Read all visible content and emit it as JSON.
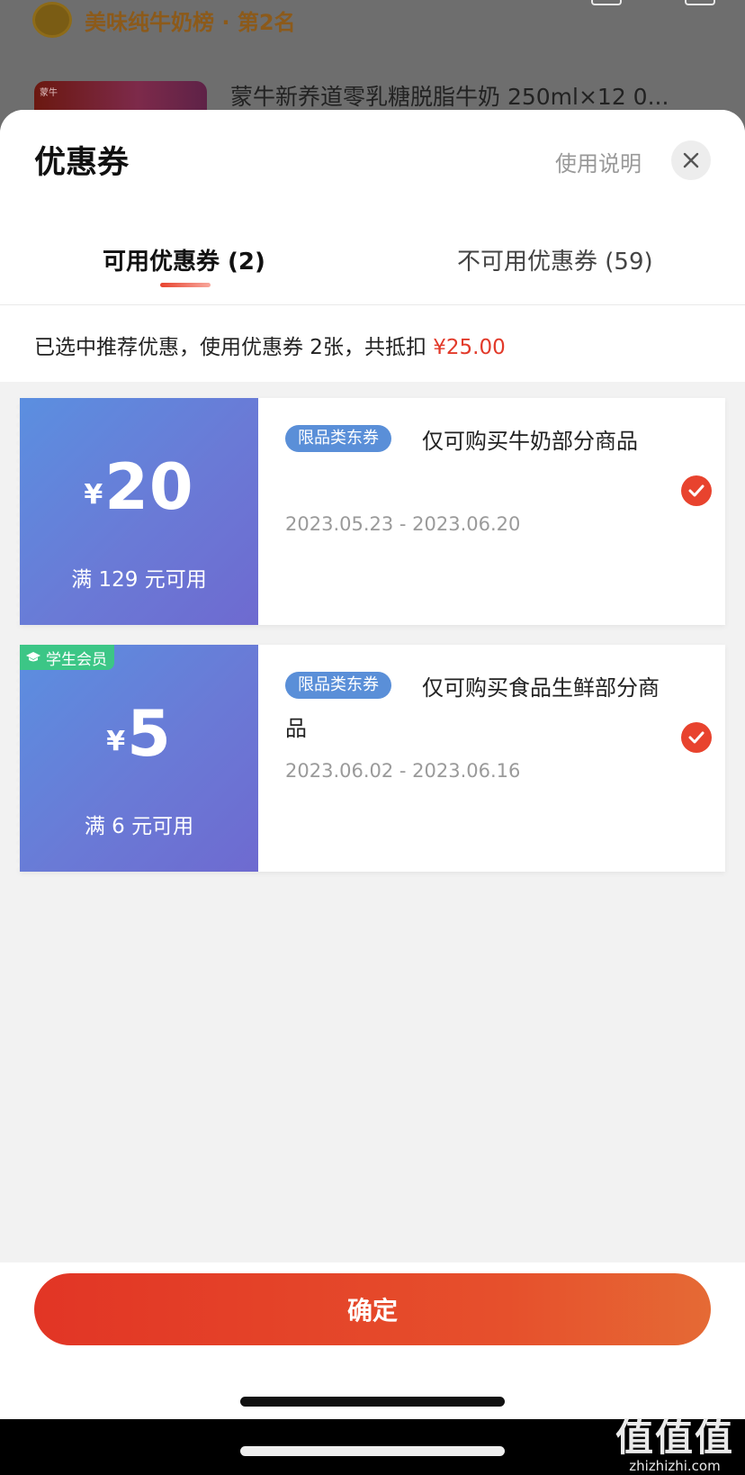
{
  "background": {
    "rank_text": "美味纯牛奶榜 · 第2名",
    "product_title": "蒙牛新养道零乳糖脱脂牛奶 250ml×12 0...",
    "thumb_brand": "蒙牛"
  },
  "sheet": {
    "title": "优惠券",
    "help_link": "使用说明",
    "close_icon": "close-icon"
  },
  "tabs": [
    {
      "label": "可用优惠券 (2)",
      "active": true
    },
    {
      "label": "不可用优惠券 (59)",
      "active": false
    }
  ],
  "summary": {
    "text": "已选中推荐优惠，使用优惠券 2张，共抵扣 ",
    "amount": "¥25.00"
  },
  "coupons": [
    {
      "currency": "¥",
      "amount": "20",
      "condition": "满 129 元可用",
      "badge": "",
      "tag": "限品类东券",
      "description": "仅可购买牛奶部分商品",
      "dates": "2023.05.23 - 2023.06.20",
      "selected": true
    },
    {
      "currency": "¥",
      "amount": "5",
      "condition": "满 6 元可用",
      "badge": "学生会员",
      "tag": "限品类东券",
      "description": "仅可购买食品生鲜部分商品",
      "dates": "2023.06.02 - 2023.06.16",
      "selected": true
    }
  ],
  "footer": {
    "confirm_label": "确定"
  },
  "watermark": {
    "big": "值值值",
    "small": "zhizhizhi.com"
  },
  "colors": {
    "accent": "#e8432e",
    "coupon_gradient_start": "#5b8fe0",
    "coupon_gradient_end": "#6e6ad0",
    "tag": "#5a8fd8",
    "student_badge": "#3cc686"
  }
}
